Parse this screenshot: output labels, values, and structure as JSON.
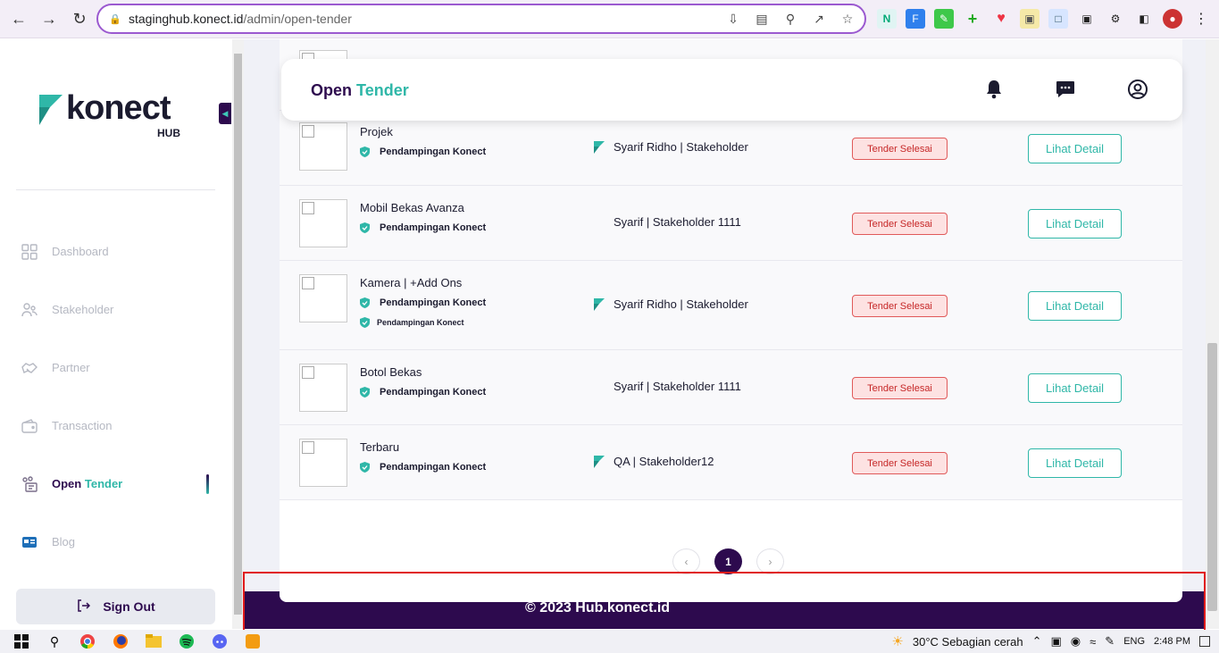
{
  "browser": {
    "url_host": "staginghub.konect.id",
    "url_path": "/admin/open-tender"
  },
  "brand": {
    "logo_text": "konect",
    "logo_sub": "HUB",
    "primary": "#2d0a4e",
    "accent": "#2fb7a8"
  },
  "sidebar": {
    "items": [
      {
        "label": "Dashboard",
        "icon": "grid-icon"
      },
      {
        "label": "Stakeholder",
        "icon": "users-icon"
      },
      {
        "label": "Partner",
        "icon": "handshake-icon"
      },
      {
        "label": "Transaction",
        "icon": "wallet-icon"
      },
      {
        "label_a": "Open",
        "label_b": "Tender",
        "icon": "tender-icon",
        "active": true
      },
      {
        "label": "Blog",
        "icon": "news-icon"
      }
    ],
    "signout_label": "Sign Out"
  },
  "header": {
    "title_a": "Open",
    "title_b": "Tender"
  },
  "table": {
    "rows": [
      {
        "name": "Projek",
        "badges": [
          "Pendampingan Konect"
        ],
        "owner": "Syarif Ridho | Stakeholder",
        "owner_icon": true,
        "status": "Tender Selesai",
        "action": "Lihat Detail"
      },
      {
        "name": "Mobil Bekas Avanza",
        "badges": [
          "Pendampingan Konect"
        ],
        "owner": "Syarif | Stakeholder 1111",
        "owner_icon": false,
        "status": "Tender Selesai",
        "action": "Lihat Detail"
      },
      {
        "name": "Kamera | +Add Ons",
        "badges": [
          "Pendampingan Konect",
          "Pendampingan Konect"
        ],
        "owner": "Syarif Ridho | Stakeholder",
        "owner_icon": true,
        "status": "Tender Selesai",
        "action": "Lihat Detail"
      },
      {
        "name": "Botol Bekas",
        "badges": [
          "Pendampingan Konect"
        ],
        "owner": "Syarif | Stakeholder 1111",
        "owner_icon": false,
        "status": "Tender Selesai",
        "action": "Lihat Detail"
      },
      {
        "name": "Terbaru",
        "badges": [
          "Pendampingan Konect"
        ],
        "owner": "QA | Stakeholder12",
        "owner_icon": true,
        "status": "Tender Selesai",
        "action": "Lihat Detail"
      }
    ]
  },
  "pagination": {
    "prev": "‹",
    "current": "1",
    "next": "›"
  },
  "footer": {
    "text": "© 2023 Hub.konect.id"
  },
  "taskbar": {
    "weather": "30°C  Sebagian cerah",
    "lang": "ENG",
    "time": "2:48 PM"
  }
}
